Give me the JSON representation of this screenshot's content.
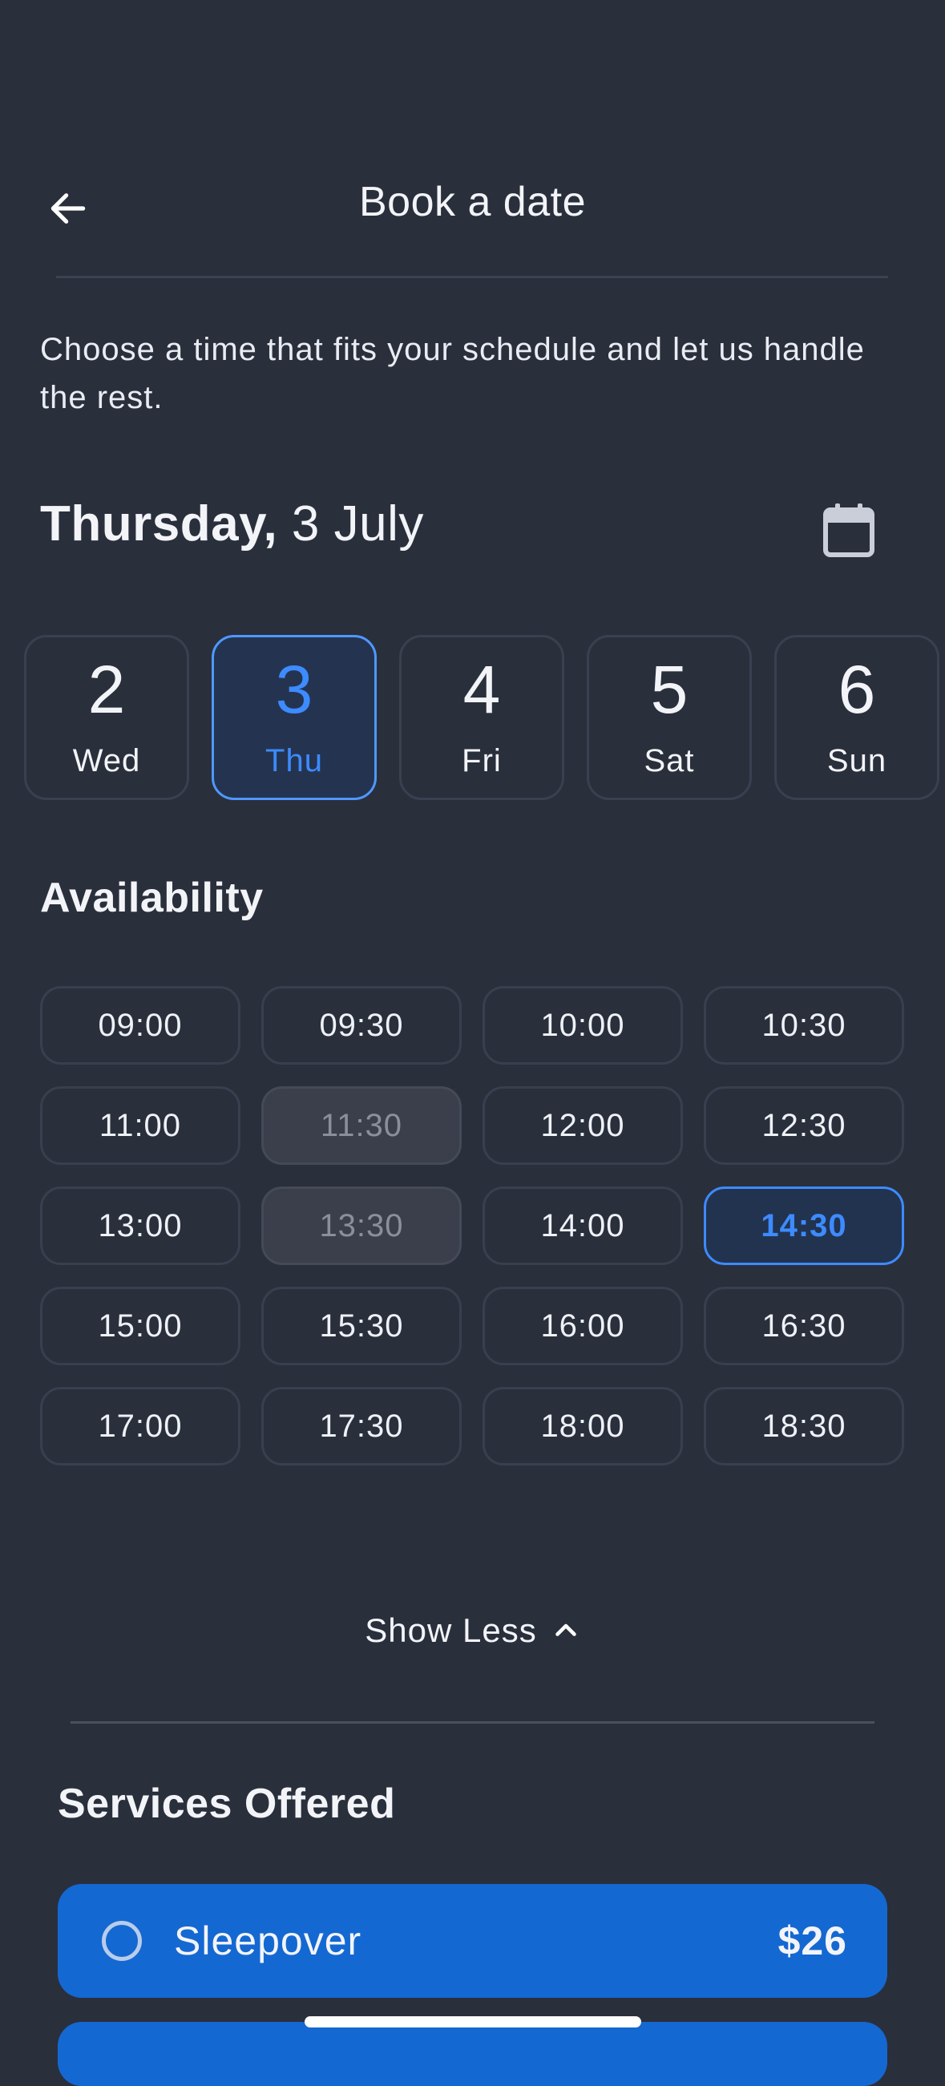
{
  "header": {
    "title": "Book a date"
  },
  "intro": "Choose a time that fits your schedule and let us handle the rest.",
  "date": {
    "weekday": "Thursday,",
    "rest": " 3 July"
  },
  "days": [
    {
      "num": "2",
      "name": "Wed",
      "selected": false
    },
    {
      "num": "3",
      "name": "Thu",
      "selected": true
    },
    {
      "num": "4",
      "name": "Fri",
      "selected": false
    },
    {
      "num": "5",
      "name": "Sat",
      "selected": false
    },
    {
      "num": "6",
      "name": "Sun",
      "selected": false
    }
  ],
  "availability": {
    "title": "Availability",
    "slots": [
      {
        "time": "09:00",
        "state": "available"
      },
      {
        "time": "09:30",
        "state": "available"
      },
      {
        "time": "10:00",
        "state": "available"
      },
      {
        "time": "10:30",
        "state": "available"
      },
      {
        "time": "11:00",
        "state": "available"
      },
      {
        "time": "11:30",
        "state": "disabled"
      },
      {
        "time": "12:00",
        "state": "available"
      },
      {
        "time": "12:30",
        "state": "available"
      },
      {
        "time": "13:00",
        "state": "available"
      },
      {
        "time": "13:30",
        "state": "disabled"
      },
      {
        "time": "14:00",
        "state": "available"
      },
      {
        "time": "14:30",
        "state": "selected"
      },
      {
        "time": "15:00",
        "state": "available"
      },
      {
        "time": "15:30",
        "state": "available"
      },
      {
        "time": "16:00",
        "state": "available"
      },
      {
        "time": "16:30",
        "state": "available"
      },
      {
        "time": "17:00",
        "state": "available"
      },
      {
        "time": "17:30",
        "state": "available"
      },
      {
        "time": "18:00",
        "state": "available"
      },
      {
        "time": "18:30",
        "state": "available"
      }
    ]
  },
  "show_less_label": "Show Less",
  "services": {
    "title": "Services Offered",
    "items": [
      {
        "name": "Sleepover",
        "price": "$26"
      }
    ]
  },
  "colors": {
    "background": "#2a2f3c",
    "accent": "#3d8bff",
    "service_bg": "#1468d2"
  }
}
